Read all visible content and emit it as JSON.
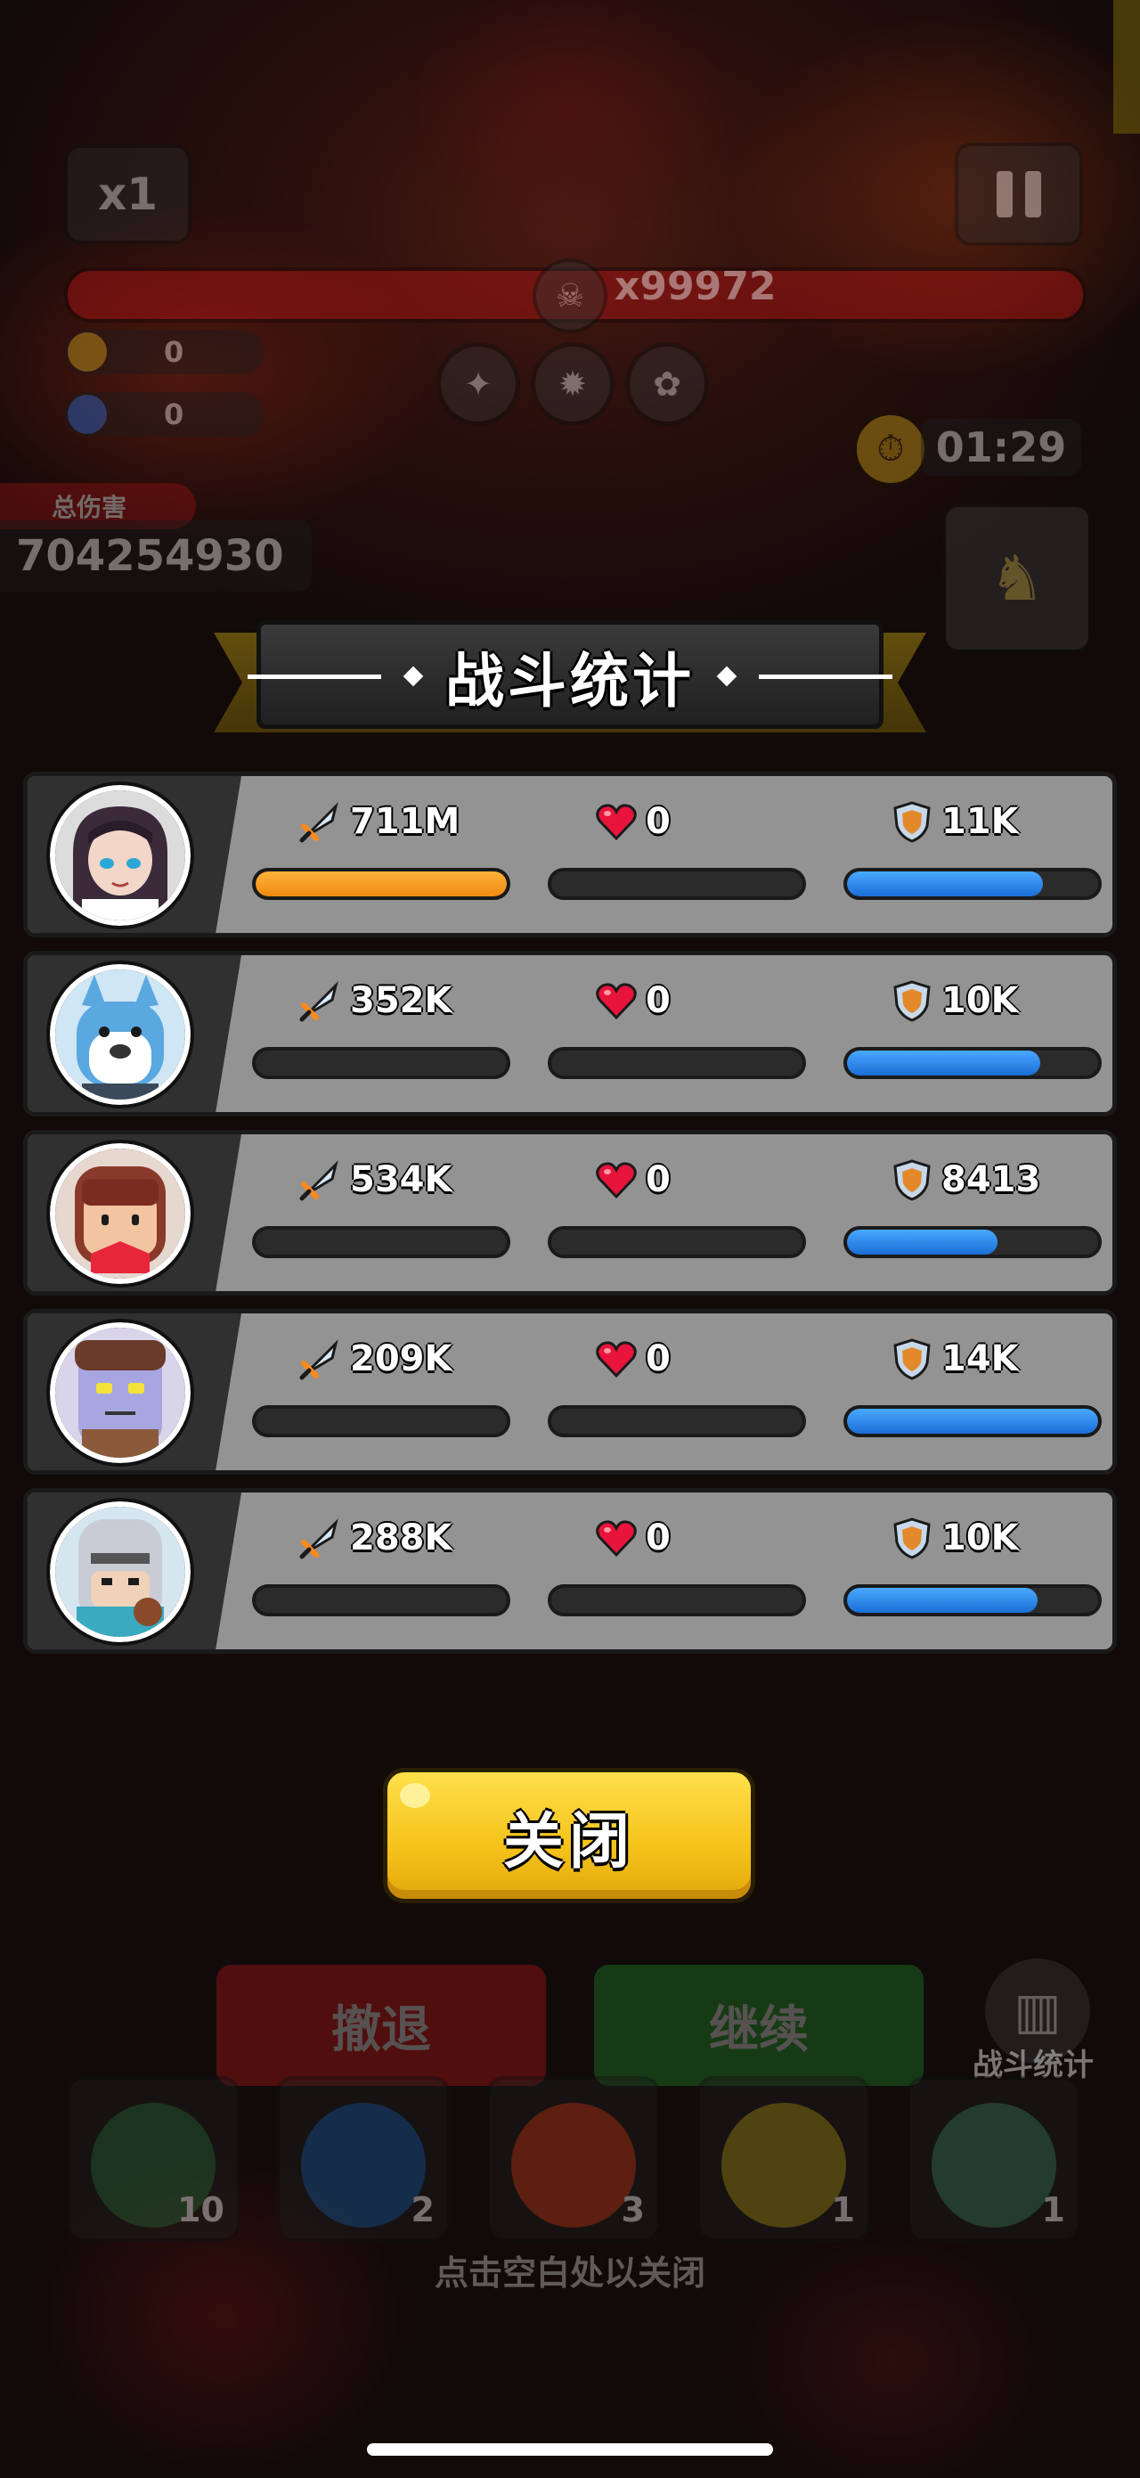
{
  "hud": {
    "speed": "x1",
    "boss_count": "x99972",
    "gold": "0",
    "gems": "0",
    "timer": "01:29",
    "total_damage_label": "总伤害",
    "total_damage_value": "704254930"
  },
  "dialog": {
    "title": "战斗统计",
    "close_label": "关闭",
    "hint": "点击空白处以关闭"
  },
  "stats": [
    {
      "damage": "711M",
      "heal": "0",
      "shield": "11K",
      "damage_fill": 1.0,
      "heal_fill": 0.0,
      "shield_fill": 0.78
    },
    {
      "damage": "352K",
      "heal": "0",
      "shield": "10K",
      "damage_fill": 0.0,
      "heal_fill": 0.0,
      "shield_fill": 0.77
    },
    {
      "damage": "534K",
      "heal": "0",
      "shield": "8413",
      "damage_fill": 0.0,
      "heal_fill": 0.0,
      "shield_fill": 0.6
    },
    {
      "damage": "209K",
      "heal": "0",
      "shield": "14K",
      "damage_fill": 0.0,
      "heal_fill": 0.0,
      "shield_fill": 1.0
    },
    {
      "damage": "288K",
      "heal": "0",
      "shield": "10K",
      "damage_fill": 0.0,
      "heal_fill": 0.0,
      "shield_fill": 0.76
    }
  ],
  "bottom": {
    "retreat_label": "撤退",
    "continue_label": "继续",
    "stats_label": "战斗统计",
    "skill_counts": [
      "10",
      "2",
      "3",
      "1",
      "1"
    ]
  },
  "icons": {
    "damage": "sword-icon",
    "heal": "heart-icon",
    "shield": "shield-icon"
  },
  "colors": {
    "damage_bar": "#f08a12",
    "shield_bar": "#1a6ed6",
    "heal_bar": "#c9133a",
    "close_button": "#f5c21a"
  }
}
